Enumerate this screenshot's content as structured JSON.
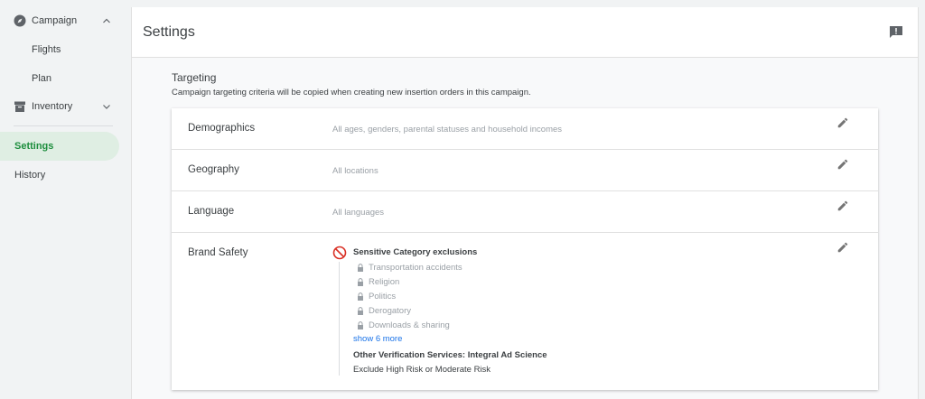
{
  "sidebar": {
    "campaign": "Campaign",
    "flights": "Flights",
    "plan": "Plan",
    "inventory": "Inventory",
    "settings": "Settings",
    "history": "History"
  },
  "header": {
    "title": "Settings"
  },
  "targeting": {
    "title": "Targeting",
    "description": "Campaign targeting criteria will be copied when creating new insertion orders in this campaign.",
    "rows": [
      {
        "label": "Demographics",
        "value": "All ages, genders, parental statuses and household incomes"
      },
      {
        "label": "Geography",
        "value": "All locations"
      },
      {
        "label": "Language",
        "value": "All languages"
      },
      {
        "label": "Brand Safety"
      }
    ]
  },
  "brand_safety": {
    "sensitive_title": "Sensitive Category exclusions",
    "exclusions": [
      "Transportation accidents",
      "Religion",
      "Politics",
      "Derogatory",
      "Downloads & sharing"
    ],
    "show_more": "show 6 more",
    "other_title": "Other Verification Services: Integral Ad Science",
    "other_desc": "Exclude High Risk or Moderate Risk"
  },
  "colors": {
    "accent_green": "#1e8e3e",
    "link_blue": "#1a73e8",
    "block_red": "#d93025"
  }
}
